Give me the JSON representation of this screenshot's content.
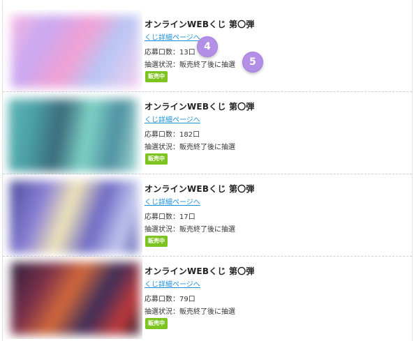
{
  "items": [
    {
      "title": "オンラインWEBくじ 第〇弾",
      "link": "くじ詳細ページへ",
      "entries_label": "応募口数：",
      "entries_value": "13口",
      "status_label": "抽選状況：",
      "status_value": "販売終了後に抽選",
      "badge": "販売中"
    },
    {
      "title": "オンラインWEBくじ 第〇弾",
      "link": "くじ詳細ページへ",
      "entries_label": "応募口数：",
      "entries_value": "182口",
      "status_label": "抽選状況：",
      "status_value": "販売終了後に抽選",
      "badge": "販売中"
    },
    {
      "title": "オンラインWEBくじ 第〇弾",
      "link": "くじ詳細ページへ",
      "entries_label": "応募口数：",
      "entries_value": "17口",
      "status_label": "抽選状況：",
      "status_value": "販売終了後に抽選",
      "badge": "販売中"
    },
    {
      "title": "オンラインWEBくじ 第〇弾",
      "link": "くじ詳細ページへ",
      "entries_label": "応募口数：",
      "entries_value": "79口",
      "status_label": "抽選状況：",
      "status_value": "販売終了後に抽選",
      "badge": "販売中"
    }
  ],
  "markers": [
    "4",
    "5"
  ],
  "colors": {
    "link": "#1a8fd8",
    "badge": "#7ec420",
    "marker": "#b48fe6"
  }
}
